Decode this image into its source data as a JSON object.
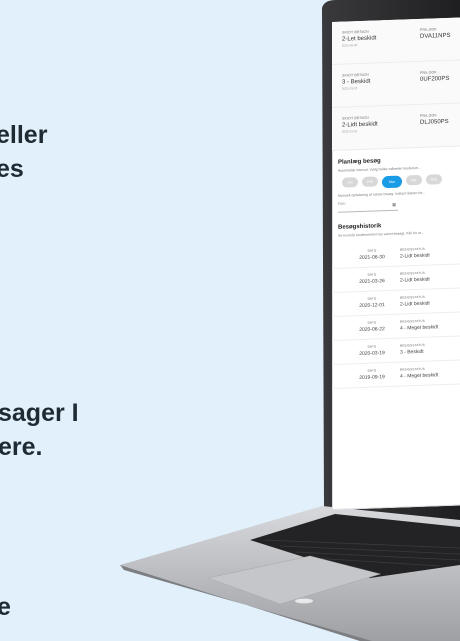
{
  "marketing": {
    "block1": [
      "eller",
      "es"
    ],
    "block2": [
      "sager I",
      "ere."
    ],
    "block3": [
      "e"
    ]
  },
  "colors": {
    "background": "#e1f0fb",
    "accent": "#1a9be6",
    "laptop_dark": "#2b2b2e",
    "laptop_silver": "#bfc1c4"
  },
  "app": {
    "reports": [
      {
        "label_a": "SKIDT BESIGN",
        "value_a": "2-Let beskidt",
        "date": "2021-06-30",
        "label_b": "PRILOOK",
        "value_b": "DVA11NPS"
      },
      {
        "label_a": "SKIDT BESIGN",
        "value_a": "3 - Beskidt",
        "date": "2021-03-26",
        "label_b": "PRILOOK",
        "value_b": "0UF200PS"
      },
      {
        "label_a": "SKIDT BESIGN",
        "value_a": "2-Lidt beskidt",
        "date": "2020-12-01",
        "label_b": "PRILOOK",
        "value_b": "DLJ050PS"
      }
    ],
    "plan": {
      "title": "Planlæg besøg",
      "desc": "Automatisk interval. Vælg hvilke måneder kruderum...",
      "chips": [
        "Jan",
        "Feb",
        "Mar",
        "Apr",
        "Maj"
      ],
      "active_chip": 2,
      "manual_desc": "Manuelt opdatering af næste besøg. Indtast datoen for...",
      "date_placeholder": "Dato",
      "calendar_icon": "calendar-icon"
    },
    "history": {
      "title": "Besøgshistorik",
      "desc": "Se hvornår kruderummet har været besøgt. Klik for at...",
      "date_label": "DATO",
      "status_label": "BESIGSSTATUS",
      "rows": [
        {
          "date": "2021-06-30",
          "status": "2-Lidt beskidt"
        },
        {
          "date": "2021-03-26",
          "status": "2-Lidt beskidt"
        },
        {
          "date": "2020-12-01",
          "status": "2-Lidt beskidt"
        },
        {
          "date": "2020-06-22",
          "status": "4 - Meget beskidt"
        },
        {
          "date": "2020-03-19",
          "status": "3 - Beskidt"
        },
        {
          "date": "2019-09-19",
          "status": "4 - Meget beskidt"
        }
      ]
    }
  }
}
